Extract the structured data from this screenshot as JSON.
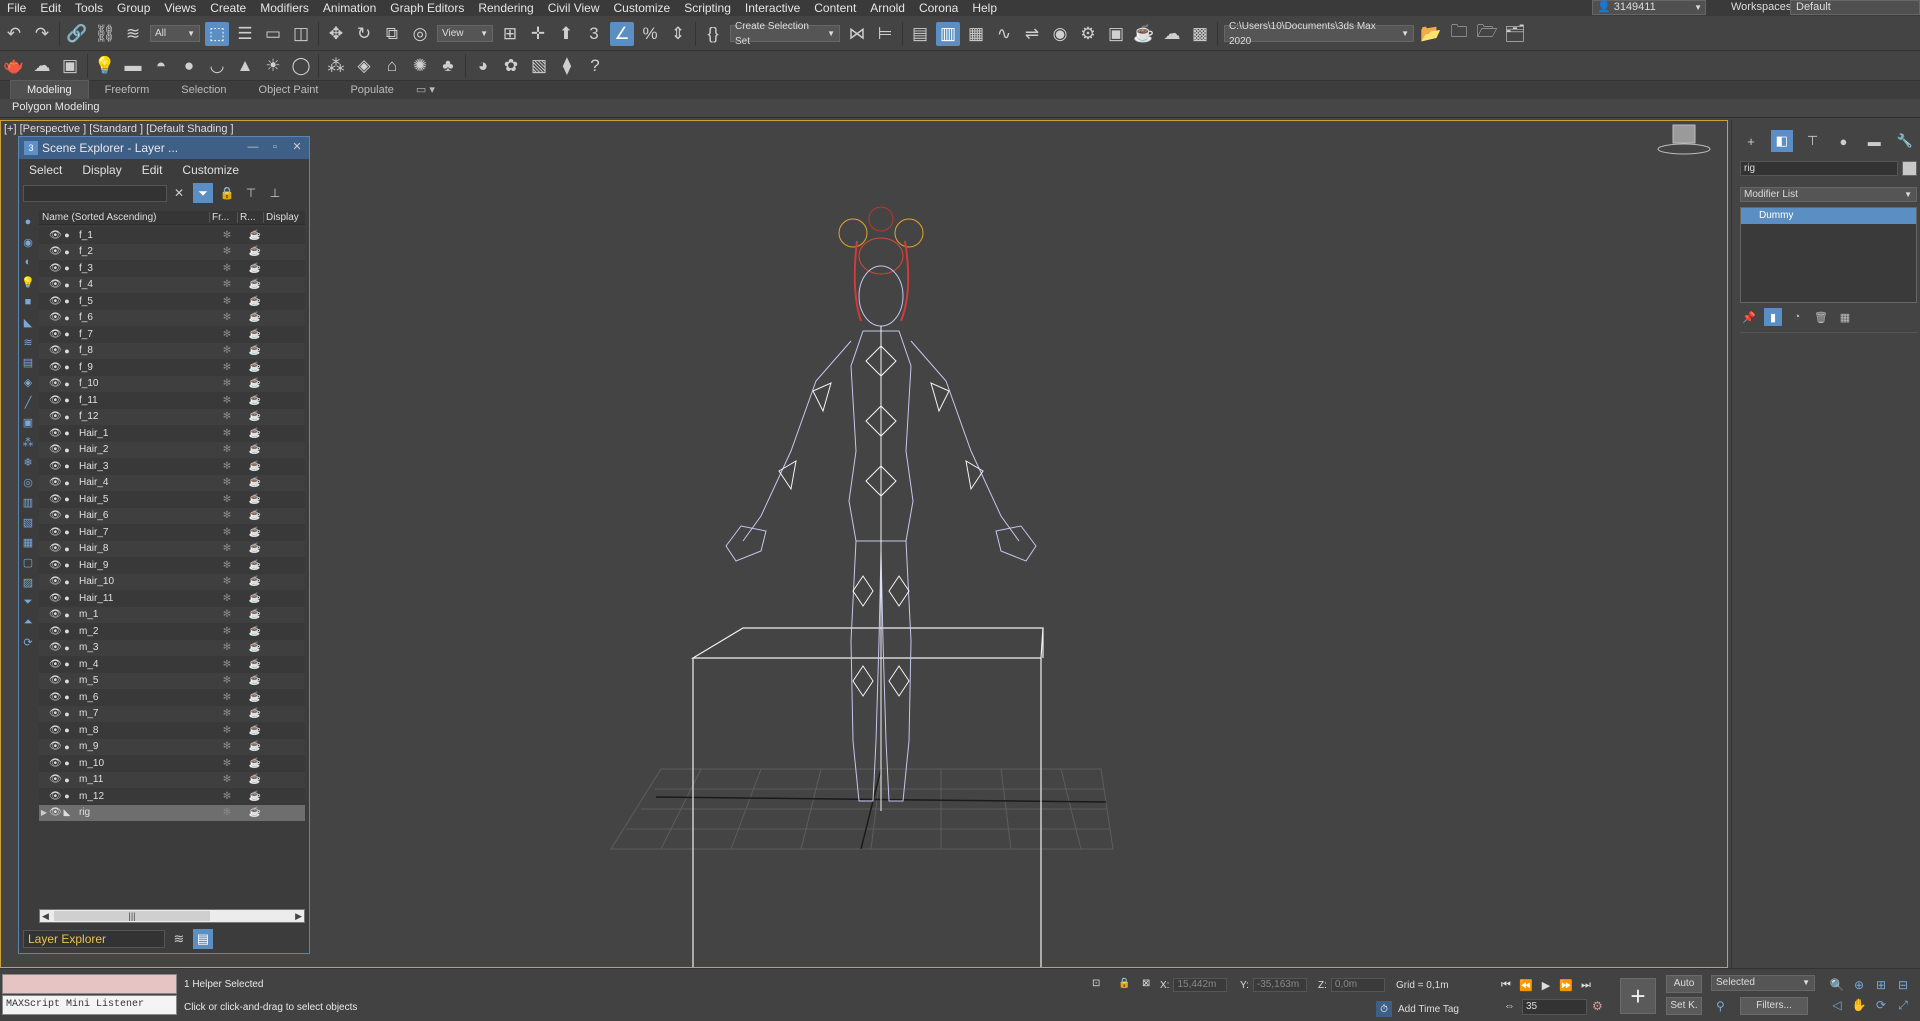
{
  "menu": [
    "File",
    "Edit",
    "Tools",
    "Group",
    "Views",
    "Create",
    "Modifiers",
    "Animation",
    "Graph Editors",
    "Rendering",
    "Civil View",
    "Customize",
    "Scripting",
    "Interactive",
    "Content",
    "Arnold",
    "Corona",
    "Help"
  ],
  "user": {
    "name": "3149411"
  },
  "workspace": {
    "label": "Workspaces:",
    "value": "Default"
  },
  "toolbar": {
    "filter_value": "All",
    "view_value": "View",
    "selection_set": "Create Selection Set",
    "project_path": "C:\\Users\\10\\Documents\\3ds Max 2020"
  },
  "ribbon": {
    "tabs": [
      "Modeling",
      "Freeform",
      "Selection",
      "Object Paint",
      "Populate"
    ],
    "sub": "Polygon Modeling"
  },
  "viewport": {
    "label": "[+] [Perspective ] [Standard ] [Default Shading ]"
  },
  "scene_explorer": {
    "title": "Scene Explorer - Layer ...",
    "menu": [
      "Select",
      "Display",
      "Edit",
      "Customize"
    ],
    "columns": {
      "name": "Name (Sorted Ascending)",
      "frozen": "Fr...",
      "render": "R...",
      "display": "Display"
    },
    "rows": [
      "f_1",
      "f_2",
      "f_3",
      "f_4",
      "f_5",
      "f_6",
      "f_7",
      "f_8",
      "f_9",
      "f_10",
      "f_11",
      "f_12",
      "Hair_1",
      "Hair_2",
      "Hair_3",
      "Hair_4",
      "Hair_5",
      "Hair_6",
      "Hair_7",
      "Hair_8",
      "Hair_9",
      "Hair_10",
      "Hair_11",
      "m_1",
      "m_2",
      "m_3",
      "m_4",
      "m_5",
      "m_6",
      "m_7",
      "m_8",
      "m_9",
      "m_10",
      "m_11",
      "m_12",
      "rig"
    ],
    "selected_row": "rig",
    "footer": "Layer Explorer"
  },
  "command_panel": {
    "object_name": "rig",
    "modifier_list": "Modifier List",
    "stack_item": "Dummy"
  },
  "status": {
    "maxscript": "MAXScript Mini Listener",
    "line1": "1 Helper Selected",
    "line2": "Click or click-and-drag to select objects",
    "x_label": "X:",
    "x": "15,442m",
    "y_label": "Y:",
    "y": "-35,163m",
    "z_label": "Z:",
    "z": "0,0m",
    "grid": "Grid = 0,1m",
    "add_time_tag": "Add Time Tag",
    "frame": "35",
    "auto": "Auto",
    "set_key": "Set K.",
    "selected": "Selected",
    "filters": "Filters..."
  }
}
